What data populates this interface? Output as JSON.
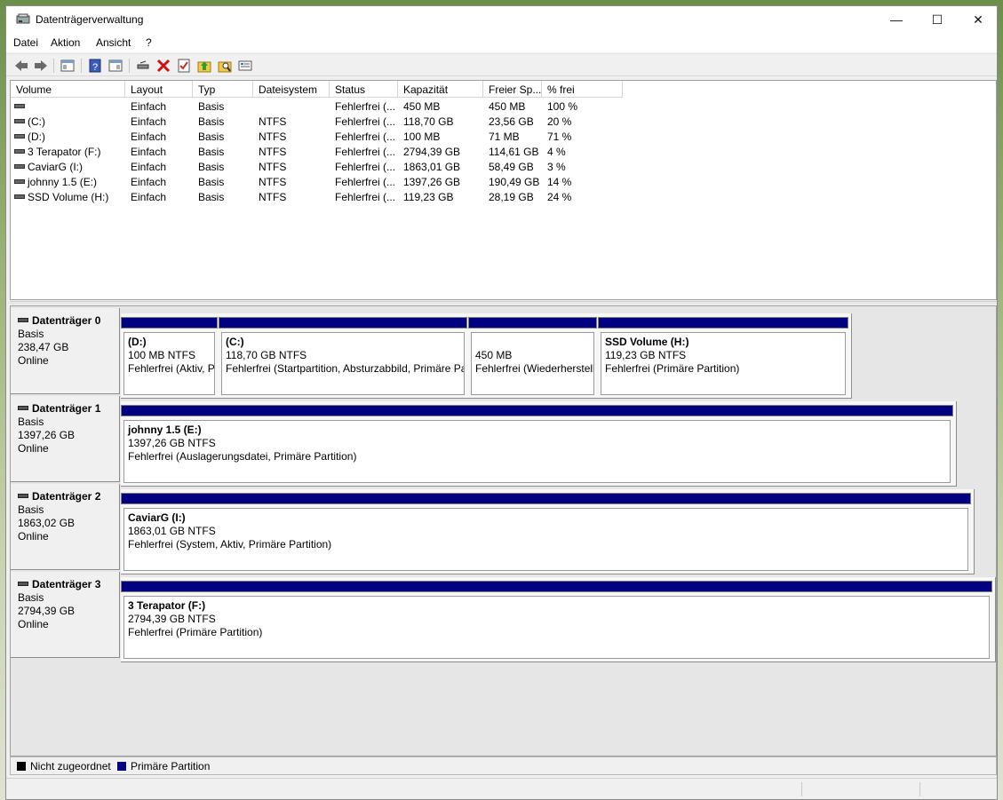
{
  "window": {
    "title": "Datenträgerverwaltung"
  },
  "menu": [
    "Datei",
    "Aktion",
    "Ansicht",
    "?"
  ],
  "toolbar": [
    "back-icon",
    "forward-icon",
    "console-tree-icon",
    "help-icon",
    "details-icon",
    "connect-icon",
    "delete-icon",
    "properties-icon",
    "up-icon",
    "find-icon",
    "format-icon"
  ],
  "volumes": {
    "headers": [
      "Volume",
      "Layout",
      "Typ",
      "Dateisystem",
      "Status",
      "Kapazität",
      "Freier Sp...",
      "% frei"
    ],
    "rows": [
      [
        "",
        "Einfach",
        "Basis",
        "",
        "Fehlerfrei (...",
        "450 MB",
        "450 MB",
        "100 %"
      ],
      [
        "(C:)",
        "Einfach",
        "Basis",
        "NTFS",
        "Fehlerfrei (...",
        "118,70 GB",
        "23,56 GB",
        "20 %"
      ],
      [
        "(D:)",
        "Einfach",
        "Basis",
        "NTFS",
        "Fehlerfrei (...",
        "100 MB",
        "71 MB",
        "71 %"
      ],
      [
        "3 Terapator (F:)",
        "Einfach",
        "Basis",
        "NTFS",
        "Fehlerfrei (...",
        "2794,39 GB",
        "114,61 GB",
        "4 %"
      ],
      [
        "CaviarG (I:)",
        "Einfach",
        "Basis",
        "NTFS",
        "Fehlerfrei (...",
        "1863,01 GB",
        "58,49 GB",
        "3 %"
      ],
      [
        "johnny 1.5 (E:)",
        "Einfach",
        "Basis",
        "NTFS",
        "Fehlerfrei (...",
        "1397,26 GB",
        "190,49 GB",
        "14 %"
      ],
      [
        "SSD Volume (H:)",
        "Einfach",
        "Basis",
        "NTFS",
        "Fehlerfrei (...",
        "119,23 GB",
        "28,19 GB",
        "24 %"
      ]
    ]
  },
  "disks": [
    {
      "name": "Datenträger 0",
      "type": "Basis",
      "size": "238,47 GB",
      "status": "Online",
      "partitions": [
        {
          "name": "(D:)",
          "size": "100 MB NTFS",
          "status": "Fehlerfrei (Aktiv, P"
        },
        {
          "name": "(C:)",
          "size": "118,70 GB NTFS",
          "status": "Fehlerfrei (Startpartition, Absturzabbild, Primäre Pa"
        },
        {
          "name": "",
          "size": "450 MB",
          "status": "Fehlerfrei (Wiederherstell"
        },
        {
          "name": "SSD Volume  (H:)",
          "size": "119,23 GB NTFS",
          "status": "Fehlerfrei (Primäre Partition)"
        }
      ]
    },
    {
      "name": "Datenträger 1",
      "type": "Basis",
      "size": "1397,26 GB",
      "status": "Online",
      "partitions": [
        {
          "name": "johnny 1.5  (E:)",
          "size": "1397,26 GB NTFS",
          "status": "Fehlerfrei (Auslagerungsdatei, Primäre Partition)"
        }
      ]
    },
    {
      "name": "Datenträger 2",
      "type": "Basis",
      "size": "1863,02 GB",
      "status": "Online",
      "partitions": [
        {
          "name": "CaviarG  (I:)",
          "size": "1863,01 GB NTFS",
          "status": "Fehlerfrei (System, Aktiv, Primäre Partition)"
        }
      ]
    },
    {
      "name": "Datenträger 3",
      "type": "Basis",
      "size": "2794,39 GB",
      "status": "Online",
      "partitions": [
        {
          "name": "3 Terapator  (F:)",
          "size": "2794,39 GB NTFS",
          "status": "Fehlerfrei (Primäre Partition)"
        }
      ]
    }
  ],
  "legend": [
    {
      "label": "Nicht zugeordnet",
      "color": "#000000"
    },
    {
      "label": "Primäre Partition",
      "color": "#000080"
    }
  ]
}
